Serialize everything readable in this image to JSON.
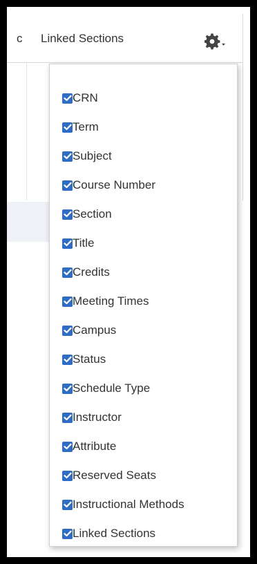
{
  "header": {
    "truncated_label": "c",
    "linked_sections_label": "Linked Sections",
    "gear_icon": "gear-icon"
  },
  "colors": {
    "checkbox": "#2f6dc5",
    "text": "#333333",
    "border": "#cfcfcf"
  },
  "column_menu": {
    "items": [
      {
        "label": "CRN",
        "checked": true
      },
      {
        "label": "Term",
        "checked": true
      },
      {
        "label": "Subject",
        "checked": true
      },
      {
        "label": "Course Number",
        "checked": true
      },
      {
        "label": "Section",
        "checked": true
      },
      {
        "label": "Title",
        "checked": true
      },
      {
        "label": "Credits",
        "checked": true
      },
      {
        "label": "Meeting Times",
        "checked": true
      },
      {
        "label": "Campus",
        "checked": true
      },
      {
        "label": "Status",
        "checked": true
      },
      {
        "label": "Schedule Type",
        "checked": true
      },
      {
        "label": "Instructor",
        "checked": true
      },
      {
        "label": "Attribute",
        "checked": true
      },
      {
        "label": "Reserved Seats",
        "checked": true
      },
      {
        "label": "Instructional Methods",
        "checked": true
      },
      {
        "label": "Linked Sections",
        "checked": true
      }
    ]
  }
}
